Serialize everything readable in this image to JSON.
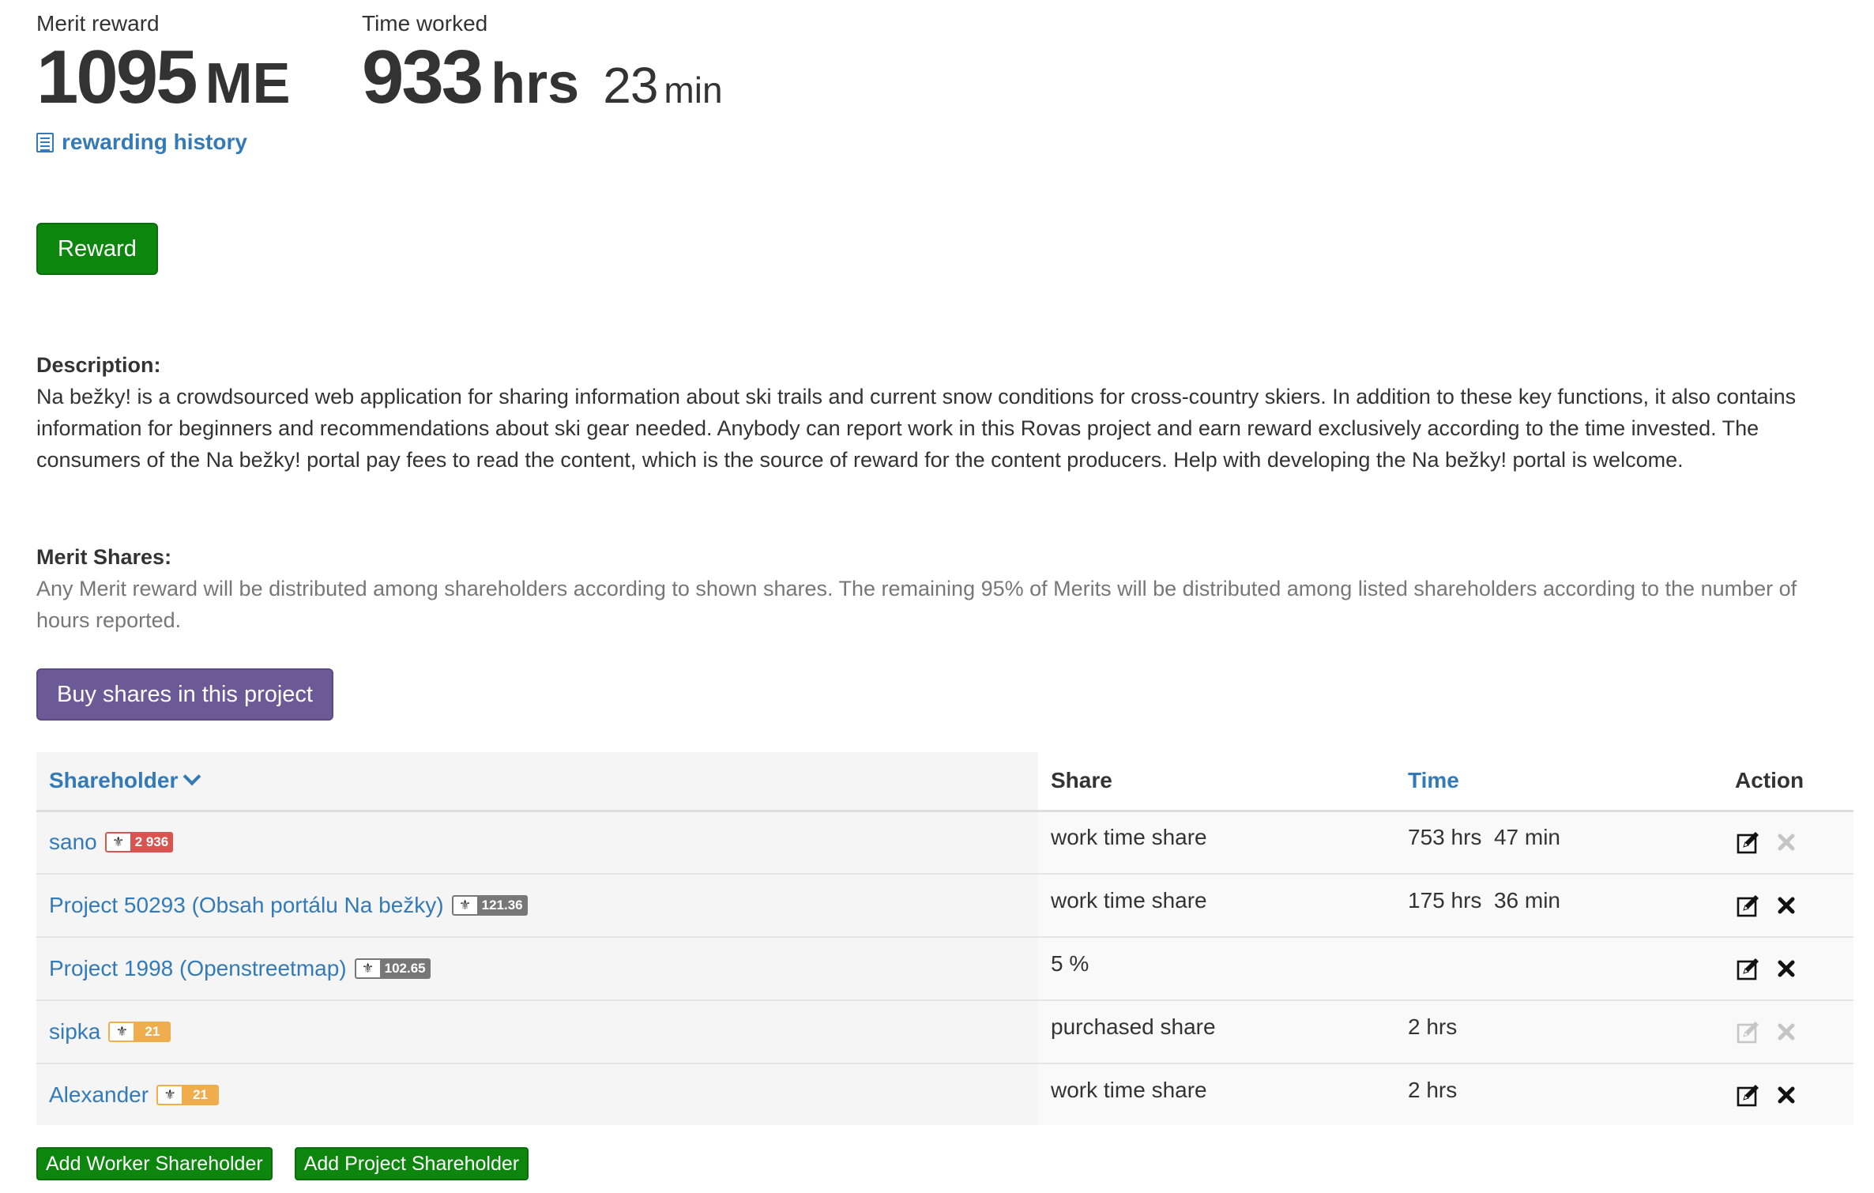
{
  "stats": {
    "merit_label": "Merit reward",
    "merit_value": "1095",
    "merit_unit": "ME",
    "time_label": "Time worked",
    "time_hours": "933",
    "time_hours_unit": "hrs",
    "time_minutes": "23",
    "time_minutes_unit": "min",
    "history_link": "rewarding history"
  },
  "buttons": {
    "reward": "Reward",
    "buy_shares": "Buy shares in this project",
    "add_worker": "Add Worker Shareholder",
    "add_project": "Add Project Shareholder"
  },
  "description": {
    "title": "Description:",
    "text": "Na bežky! is a crowdsourced web application for sharing information about ski trails and current snow conditions for cross-country skiers. In addition to these key functions, it also contains information for beginners and recommendations about ski gear needed. Anybody can report work in this Rovas project and earn reward exclusively according to the time invested. The consumers of the Na bežky! portal pay fees to read the  content, which is the source of reward for the content producers. Help with developing the Na bežky! portal is welcome."
  },
  "merit_shares": {
    "title": "Merit Shares:",
    "text": "Any Merit reward will be distributed among shareholders according to shown shares. The remaining 95% of Merits will be distributed among listed shareholders according to the number of hours reported."
  },
  "table": {
    "headers": {
      "shareholder": "Shareholder",
      "share": "Share",
      "time": "Time",
      "action": "Action"
    },
    "rows": [
      {
        "name": "sano",
        "badge": "2 936",
        "badge_color": "#d9534f",
        "share": "work time share",
        "time": "753 hrs  47 min",
        "edit_enabled": true,
        "delete_enabled": false
      },
      {
        "name": "Project 50293 (Obsah portálu Na bežky)",
        "badge": "121.36",
        "badge_color": "#777777",
        "share": "work time share",
        "time": "175 hrs  36 min",
        "edit_enabled": true,
        "delete_enabled": true
      },
      {
        "name": "Project 1998 (Openstreetmap)",
        "badge": "102.65",
        "badge_color": "#777777",
        "share": "5 %",
        "time": "",
        "edit_enabled": true,
        "delete_enabled": true
      },
      {
        "name": "sipka",
        "badge": "21",
        "badge_color": "#f0ad4e",
        "share": "purchased share",
        "time": "2 hrs",
        "edit_enabled": false,
        "delete_enabled": false
      },
      {
        "name": "Alexander",
        "badge": "21",
        "badge_color": "#f0ad4e",
        "share": "work time share",
        "time": "2 hrs",
        "edit_enabled": true,
        "delete_enabled": true
      }
    ]
  },
  "icons": {
    "history": "list-icon",
    "sort": "chevron-down-icon",
    "badge": "people-icon",
    "edit": "edit-icon",
    "delete": "close-icon"
  },
  "colors": {
    "link": "#337ab7",
    "reward_button": "#0c860c",
    "buy_button": "#6c5a96"
  }
}
